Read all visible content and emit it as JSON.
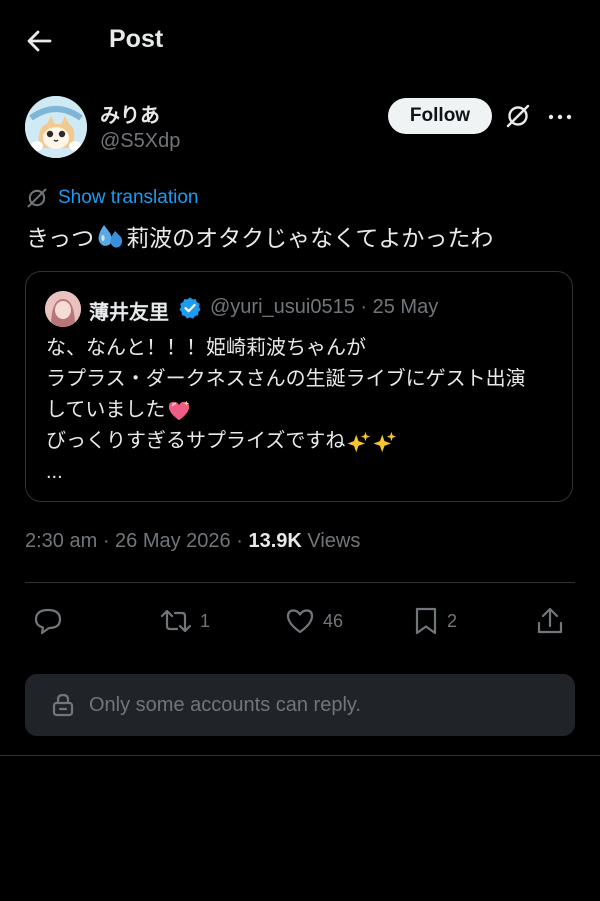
{
  "header": {
    "title": "Post",
    "back_icon": "arrow-left-icon"
  },
  "author": {
    "name": "みりあ",
    "handle": "@S5Xdp",
    "follow_label": "Follow"
  },
  "post": {
    "translate_label": "Show translation",
    "text_before_emoji": "きっつ",
    "emoji": "sweat-droplets-emoji",
    "text_after_emoji": "莉波のオタクじゃなくてよかったわ"
  },
  "quote": {
    "name": "薄井友里",
    "handle_date": "@yuri_usui0515 · 25 May",
    "lines": [
      "な、なんと！！！姫崎莉波ちゃんが",
      "ラプラス・ダークネスさんの生誕ライブにゲスト出演",
      "していました",
      "びっくりすぎるサプライズですね",
      "..."
    ],
    "line3_emoji": "sparkling-heart-emoji",
    "line4_emoji": "sparkles-emoji"
  },
  "meta": {
    "timestamp": "2:30 am · 26 May 2026 · ",
    "views_count": "13.9K",
    "views_label": " Views"
  },
  "actions": {
    "reposts": "1",
    "likes": "46",
    "bookmarks": "2"
  },
  "reply": {
    "restriction_text": "Only some accounts can reply."
  },
  "colors": {
    "accent": "#1d9bf0",
    "background": "#000000",
    "muted": "#71767b",
    "text": "#e7e9ea"
  }
}
